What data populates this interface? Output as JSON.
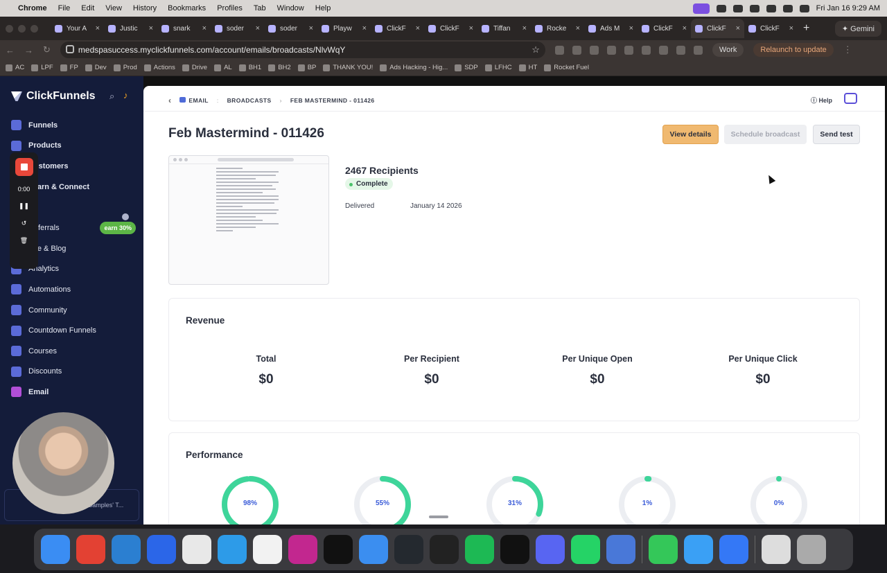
{
  "menubar": {
    "app": "Chrome",
    "items": [
      "File",
      "Edit",
      "View",
      "History",
      "Bookmarks",
      "Profiles",
      "Tab",
      "Window",
      "Help"
    ],
    "clock": "Fri Jan 16  9:29 AM"
  },
  "tabs": [
    {
      "label": "Your A"
    },
    {
      "label": "Justic"
    },
    {
      "label": "snark"
    },
    {
      "label": "soder"
    },
    {
      "label": "soder"
    },
    {
      "label": "Playw"
    },
    {
      "label": "ClickF"
    },
    {
      "label": "ClickF"
    },
    {
      "label": "Tiffan"
    },
    {
      "label": "Rocke"
    },
    {
      "label": "Ads M"
    },
    {
      "label": "ClickF"
    },
    {
      "label": "ClickF"
    },
    {
      "label": "ClickF"
    }
  ],
  "gemini_label": "Gemini",
  "address": {
    "url": "medspasuccess.myclickfunnels.com/account/emails/broadcasts/NlvWqY",
    "work_label": "Work",
    "relaunch_label": "Relaunch to update"
  },
  "bookmarks": [
    "AC",
    "LPF",
    "FP",
    "Dev",
    "Prod",
    "Actions",
    "Drive",
    "AL",
    "BH1",
    "BH2",
    "BP",
    "THANK YOU!",
    "Ads Hacking - Hig...",
    "SDP",
    "LFHC",
    "HT",
    "Rocket Fuel"
  ],
  "sidebar": {
    "brand": "ClickFunnels",
    "items": [
      {
        "label": "Funnels"
      },
      {
        "label": "Products"
      },
      {
        "label": "Customers"
      },
      {
        "label": "Learn & Connect"
      },
      {
        "label": "Referrals"
      },
      {
        "label": "Site & Blog"
      },
      {
        "label": "Analytics"
      },
      {
        "label": "Automations"
      },
      {
        "label": "Community"
      },
      {
        "label": "Countdown Funnels"
      },
      {
        "label": "Courses"
      },
      {
        "label": "Discounts"
      },
      {
        "label": "Email"
      }
    ],
    "earn_badge": "earn 30%",
    "recorder_time": "0:00",
    "bottom_card": "Tiffany Happe-Samples' T..."
  },
  "breadcrumb": {
    "email": "EMAIL",
    "broadcasts": "BROADCASTS",
    "current": "FEB MASTERMIND - 011426"
  },
  "help_label": "Help",
  "page": {
    "title": "Feb Mastermind - 011426",
    "view_details": "View details",
    "schedule": "Schedule broadcast",
    "send_test": "Send test",
    "recipients": "2467 Recipients",
    "status": "Complete",
    "delivered_label": "Delivered",
    "delivered_date": "January 14 2026"
  },
  "revenue": {
    "heading": "Revenue",
    "metrics": [
      {
        "label": "Total",
        "value": "$0"
      },
      {
        "label": "Per Recipient",
        "value": "$0"
      },
      {
        "label": "Per Unique Open",
        "value": "$0"
      },
      {
        "label": "Per Unique Click",
        "value": "$0"
      }
    ]
  },
  "performance": {
    "heading": "Performance",
    "gauges": [
      {
        "label": "98%",
        "value": 0.98
      },
      {
        "label": "55%",
        "value": 0.55
      },
      {
        "label": "31%",
        "value": 0.31
      },
      {
        "label": "1%",
        "value": 0.01
      },
      {
        "label": "0%",
        "value": 0
      }
    ],
    "track_color": "#eceef2",
    "fill_color": "#3ed59a"
  }
}
